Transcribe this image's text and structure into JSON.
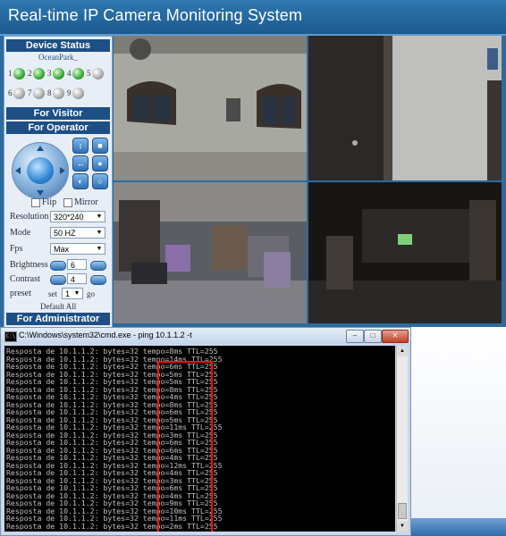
{
  "header": {
    "title": "Real-time IP Camera Monitoring System"
  },
  "sidebar": {
    "device_status": {
      "heading": "Device Status",
      "name": "OceanPark_",
      "channels": [
        "1",
        "2",
        "3",
        "4",
        "5",
        "6",
        "7",
        "8",
        "9"
      ]
    },
    "for_visitor": "For Visitor",
    "for_operator": "For Operator",
    "flip_label": "Flip",
    "mirror_label": "Mirror",
    "resolution": {
      "label": "Resolution",
      "value": "320*240"
    },
    "mode": {
      "label": "Mode",
      "value": "50 HZ"
    },
    "fps": {
      "label": "Fps",
      "value": "Max"
    },
    "brightness": {
      "label": "Brightness",
      "value": "6"
    },
    "contrast": {
      "label": "Contrast",
      "value": "4"
    },
    "preset": {
      "label": "preset",
      "set_label": "set",
      "value": "1",
      "go_label": "go"
    },
    "default_all": "Default All",
    "for_administrator": "For Administrator"
  },
  "cmd": {
    "title": "C:\\Windows\\system32\\cmd.exe - ping  10.1.1.2 -t",
    "lines": [
      "Resposta de 10.1.1.2: bytes=32 tempo=8ms TTL=255",
      "Resposta de 10.1.1.2: bytes=32 tempo=14ms TTL=255",
      "Resposta de 10.1.1.2: bytes=32 tempo=6ms TTL=255",
      "Resposta de 10.1.1.2: bytes=32 tempo=5ms TTL=255",
      "Resposta de 10.1.1.2: bytes=32 tempo=5ms TTL=255",
      "Resposta de 10.1.1.2: bytes=32 tempo=8ms TTL=255",
      "Resposta de 10.1.1.2: bytes=32 tempo=4ms TTL=255",
      "Resposta de 10.1.1.2: bytes=32 tempo=8ms TTL=255",
      "Resposta de 10.1.1.2: bytes=32 tempo=6ms TTL=255",
      "Resposta de 10.1.1.2: bytes=32 tempo=5ms TTL=255",
      "Resposta de 10.1.1.2: bytes=32 tempo=11ms TTL=255",
      "Resposta de 10.1.1.2: bytes=32 tempo=3ms TTL=255",
      "Resposta de 10.1.1.2: bytes=32 tempo=6ms TTL=255",
      "Resposta de 10.1.1.2: bytes=32 tempo=6ms TTL=255",
      "Resposta de 10.1.1.2: bytes=32 tempo=4ms TTL=255",
      "Resposta de 10.1.1.2: bytes=32 tempo=12ms TTL=255",
      "Resposta de 10.1.1.2: bytes=32 tempo=4ms TTL=255",
      "Resposta de 10.1.1.2: bytes=32 tempo=3ms TTL=255",
      "Resposta de 10.1.1.2: bytes=32 tempo=6ms TTL=255",
      "Resposta de 10.1.1.2: bytes=32 tempo=4ms TTL=255",
      "Resposta de 10.1.1.2: bytes=32 tempo=9ms TTL=255",
      "Resposta de 10.1.1.2: bytes=32 tempo=10ms TTL=255",
      "Resposta de 10.1.1.2: bytes=32 tempo=11ms TTL=255",
      "Resposta de 10.1.1.2: bytes=32 tempo=2ms TTL=255"
    ]
  }
}
